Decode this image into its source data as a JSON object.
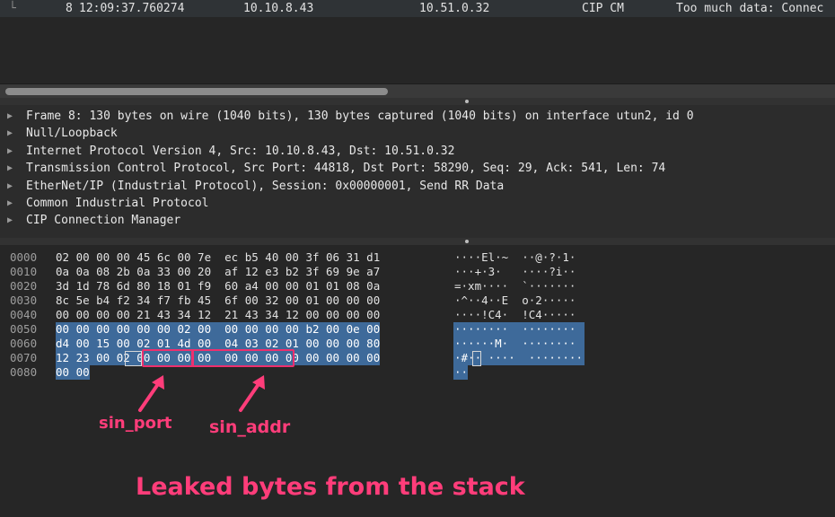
{
  "packet_row": {
    "number": "8",
    "time": "12:09:37.760274",
    "source": "10.10.8.43",
    "destination": "10.51.0.32",
    "protocol": "CIP CM",
    "info": "Too much data: Connec"
  },
  "tree": [
    "Frame 8: 130 bytes on wire (1040 bits), 130 bytes captured (1040 bits) on interface utun2, id 0",
    "Null/Loopback",
    "Internet Protocol Version 4, Src: 10.10.8.43, Dst: 10.51.0.32",
    "Transmission Control Protocol, Src Port: 44818, Dst Port: 58290, Seq: 29, Ack: 541, Len: 74",
    "EtherNet/IP (Industrial Protocol), Session: 0x00000001, Send RR Data",
    "Common Industrial Protocol",
    "CIP Connection Manager"
  ],
  "hex": {
    "offsets": [
      "0000",
      "0010",
      "0020",
      "0030",
      "0040",
      "0050",
      "0060",
      "0070",
      "0080"
    ],
    "bytes": [
      "02 00 00 00 45 6c 00 7e  ec b5 40 00 3f 06 31 d1",
      "0a 0a 08 2b 0a 33 00 20  af 12 e3 b2 3f 69 9e a7",
      "3d 1d 78 6d 80 18 01 f9  60 a4 00 00 01 01 08 0a",
      "8c 5e b4 f2 34 f7 fb 45  6f 00 32 00 01 00 00 00",
      "00 00 00 00 21 43 34 12  21 43 34 12 00 00 00 00",
      "00 00 00 00 00 00 02 00  00 00 00 00 b2 00 0e 00",
      "d4 00 15 00 02 01 4d 00  04 03 02 01 00 00 00 80",
      "12 23 00 02 00 00 00 00  00 00 00 00 00 00 00 00",
      "00 00"
    ],
    "ascii": [
      "····El·~  ··@·?·1·",
      "···+·3·   ····?i··",
      "=·xm····  `·······",
      "·^··4··E  o·2·····",
      "····!C4·  !C4·····",
      "········  ········",
      "······M·  ········",
      "·#··￼····  ········",
      "··"
    ]
  },
  "annotations": {
    "sin_port": "sin_port",
    "sin_addr": "sin_addr",
    "caption": "Leaked bytes from the stack",
    "color": "#ff3d7a"
  },
  "colors": {
    "selection": "#3e6a9a",
    "background": "#262626"
  }
}
